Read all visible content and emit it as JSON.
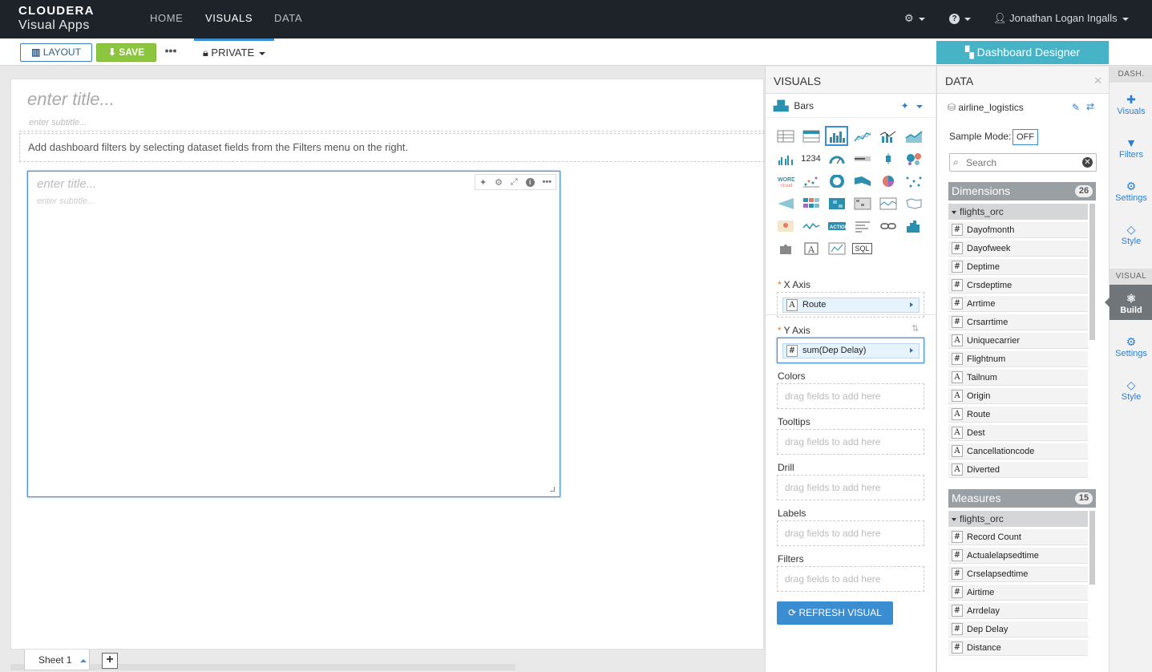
{
  "brand": {
    "line1": "CLOUDERA",
    "line2": "Visual Apps"
  },
  "nav": {
    "home": "HOME",
    "visuals": "VISUALS",
    "data": "DATA"
  },
  "user": {
    "name": "Jonathan Logan Ingalls"
  },
  "toolbar": {
    "layout": "LAYOUT",
    "save": "SAVE",
    "more": "•••",
    "privacy": "PRIVATE",
    "designer": "Dashboard Designer"
  },
  "dashboard": {
    "title_placeholder": "enter title...",
    "subtitle_placeholder": "enter subtitle...",
    "filters_hint": "Add dashboard filters by selecting dataset fields from the Filters menu on the right."
  },
  "visual": {
    "title_placeholder": "enter title...",
    "subtitle_placeholder": "enter subtitle..."
  },
  "sheet": {
    "name": "Sheet 1",
    "add": "+"
  },
  "visuals_panel": {
    "heading": "VISUALS",
    "selected_type": "Bars",
    "type_icons": [
      "table",
      "crosstab",
      "bars",
      "lines",
      "combo",
      "areas",
      "grouped-bars",
      "kpi",
      "gauge",
      "bullet",
      "box-plot",
      "packed-bubbles",
      "word-cloud",
      "scatter",
      "pie",
      "sankey",
      "radial",
      "network",
      "funnel",
      "heatmap",
      "correlation-heatmap",
      "calendar-heatmap",
      "map",
      "choropleth",
      "interactive-map",
      "sparklines",
      "action",
      "rich-text",
      "link",
      "histogram",
      "extension",
      "text",
      "field-stats",
      "sql"
    ],
    "kpi_label": "1234",
    "action_label": "ACTION",
    "sql_label": "SQL",
    "x_axis": {
      "label": "X Axis",
      "field": "Route",
      "type": "A"
    },
    "y_axis": {
      "label": "Y Axis",
      "field": "sum(Dep Delay)",
      "type": "#"
    },
    "shelves": [
      {
        "label": "Colors",
        "placeholder": "drag fields to add here"
      },
      {
        "label": "Tooltips",
        "placeholder": "drag fields to add here"
      },
      {
        "label": "Drill",
        "placeholder": "drag fields to add here"
      },
      {
        "label": "Labels",
        "placeholder": "drag fields to add here"
      },
      {
        "label": "Filters",
        "placeholder": "drag fields to add here"
      }
    ],
    "refresh": "REFRESH VISUAL"
  },
  "data_panel": {
    "heading": "DATA",
    "dataset": "airline_logistics",
    "sample_mode_label": "Sample Mode:",
    "sample_mode_value": "OFF",
    "search_placeholder": "Search",
    "dimensions": {
      "label": "Dimensions",
      "count": "26",
      "group": "flights_orc",
      "fields": [
        {
          "t": "#",
          "n": "Dayofmonth"
        },
        {
          "t": "#",
          "n": "Dayofweek"
        },
        {
          "t": "#",
          "n": "Deptime"
        },
        {
          "t": "#",
          "n": "Crsdeptime"
        },
        {
          "t": "#",
          "n": "Arrtime"
        },
        {
          "t": "#",
          "n": "Crsarrtime"
        },
        {
          "t": "A",
          "n": "Uniquecarrier"
        },
        {
          "t": "#",
          "n": "Flightnum"
        },
        {
          "t": "A",
          "n": "Tailnum"
        },
        {
          "t": "A",
          "n": "Origin"
        },
        {
          "t": "A",
          "n": "Route"
        },
        {
          "t": "A",
          "n": "Dest"
        },
        {
          "t": "A",
          "n": "Cancellationcode"
        },
        {
          "t": "A",
          "n": "Diverted"
        }
      ]
    },
    "measures": {
      "label": "Measures",
      "count": "15",
      "group": "flights_orc",
      "fields": [
        {
          "t": "#",
          "n": "Record Count"
        },
        {
          "t": "#",
          "n": "Actualelapsedtime"
        },
        {
          "t": "#",
          "n": "Crselapsedtime"
        },
        {
          "t": "#",
          "n": "Airtime"
        },
        {
          "t": "#",
          "n": "Arrdelay"
        },
        {
          "t": "#",
          "n": "Dep Delay"
        },
        {
          "t": "#",
          "n": "Distance"
        }
      ]
    }
  },
  "rail": {
    "dash_section": "DASH.",
    "dash_items": [
      {
        "icon": "✚",
        "label": "Visuals"
      },
      {
        "icon": "▼",
        "label": "Filters"
      },
      {
        "icon": "⚙",
        "label": "Settings"
      },
      {
        "icon": "◇",
        "label": "Style"
      }
    ],
    "visual_section": "VISUAL",
    "visual_items": [
      {
        "icon": "⚛",
        "label": "Build"
      },
      {
        "icon": "⚙",
        "label": "Settings"
      },
      {
        "icon": "◇",
        "label": "Style"
      }
    ]
  },
  "colors": {
    "accent": "#3a8fd3",
    "save": "#8cc63f",
    "designer": "#47b3c6",
    "navbar": "#1d2329",
    "icon_teal": "#2b8fb0"
  }
}
